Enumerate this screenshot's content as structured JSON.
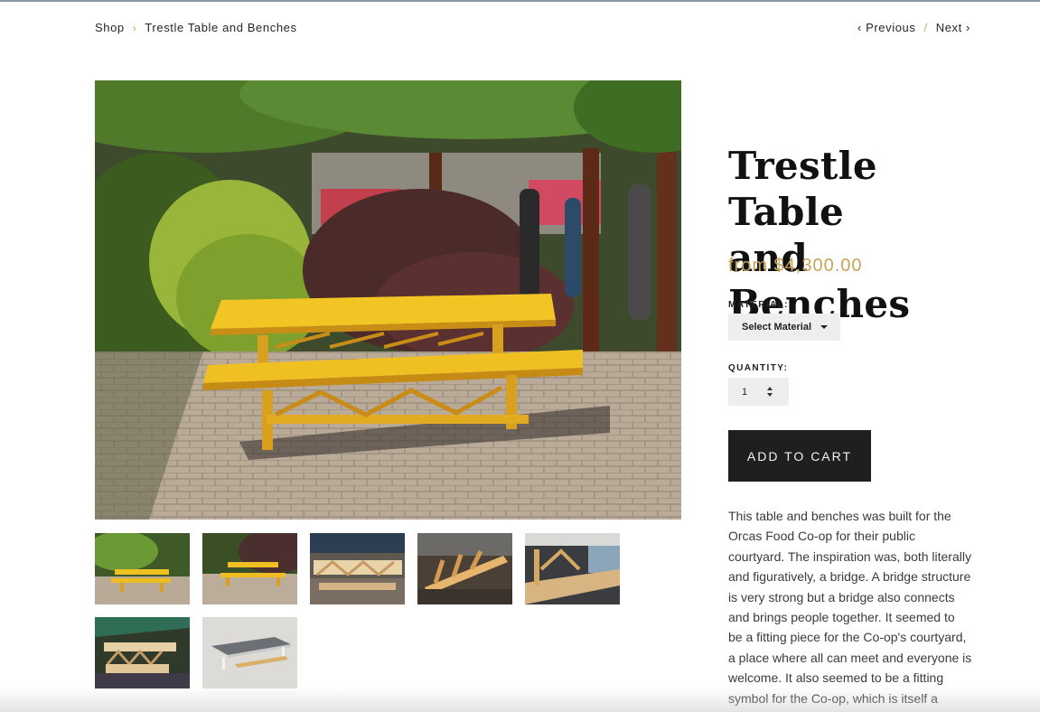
{
  "breadcrumb": {
    "shop": "Shop",
    "separator": "›",
    "current": "Trestle Table and Benches"
  },
  "pager": {
    "previous": "‹ Previous",
    "slash": "/",
    "next": "Next ›"
  },
  "product": {
    "title_line1": "Trestle Table",
    "title_line2": "and Benches",
    "price": "from $4,300.00",
    "material_label": "MATERIAL:",
    "material_value": "Select Material",
    "quantity_label": "QUANTITY:",
    "quantity_value": "1",
    "add_to_cart": "ADD TO CART",
    "description_lines": [
      "This table and benches was built for the",
      "Orcas Food Co-op for their public",
      "courtyard. The inspiration was, both literally",
      "and figuratively, a bridge. A bridge structure",
      "is very strong but a bridge also connects",
      "and brings people together. It seemed to",
      "be a fitting piece for the Co-op's courtyard,",
      "a place where all can meet and everyone is",
      "welcome. It also seemed to be a fitting",
      "symbol for the Co-op, which is itself a"
    ]
  },
  "colors": {
    "accent": "#c8a45a",
    "button_bg": "#1f1f1f",
    "field_bg": "#eeeeee",
    "wood": "#e8b425"
  },
  "icons": {
    "breadcrumb_separator": "chevron-right-icon",
    "select_caret": "caret-down-icon",
    "quantity_stepper": "up-down-stepper-icon"
  }
}
